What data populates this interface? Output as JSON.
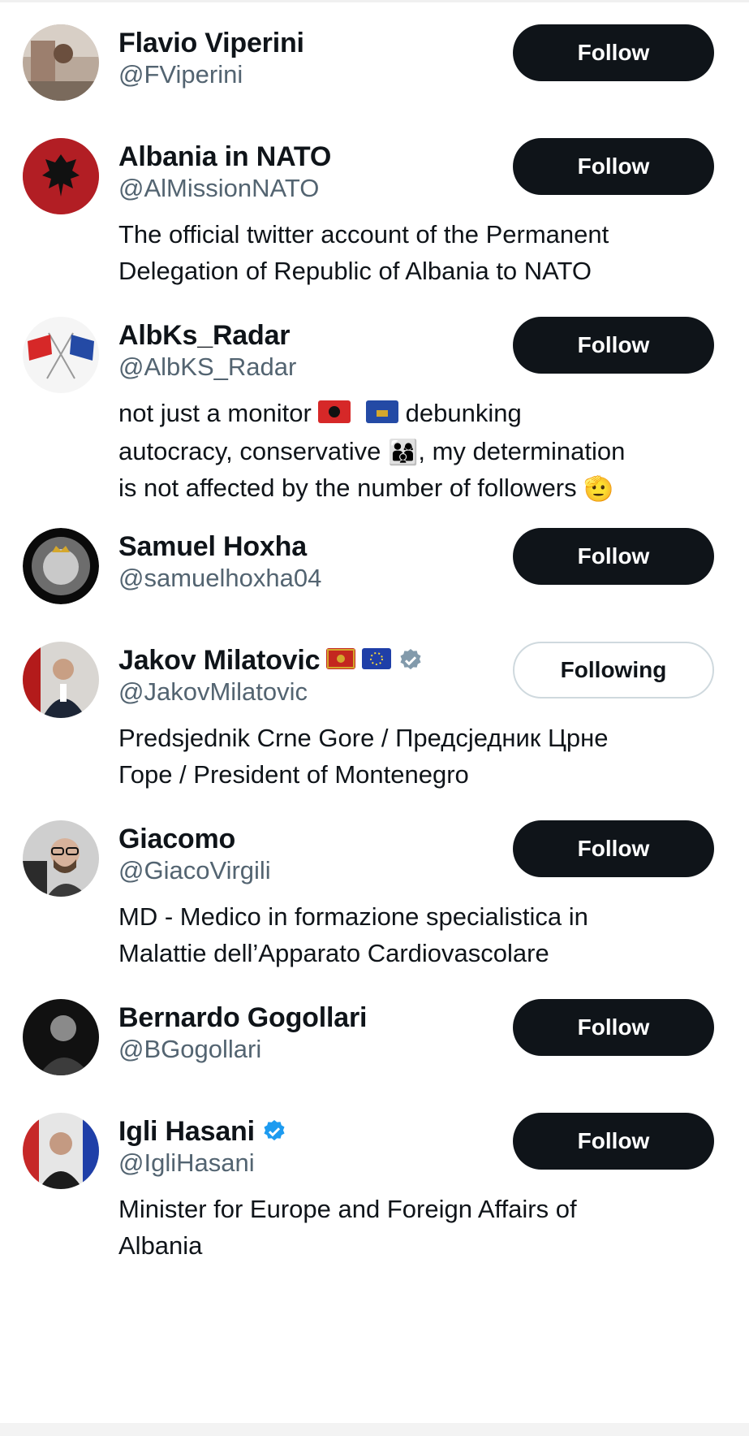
{
  "colors": {
    "text_primary": "#0f1419",
    "text_secondary": "#536471",
    "follow_button_bg": "#0f1419",
    "following_border": "#cfd9de",
    "verified_blue": "#1d9bf0",
    "verified_gray": "#829aab"
  },
  "users": [
    {
      "name": "Flavio Viperini",
      "handle": "@FViperini",
      "bio_lines": [],
      "button": "Follow"
    },
    {
      "name": "Albania in NATO",
      "handle": "@AlMissionNATO",
      "bio_lines": [
        "The official twitter account of the Permanent",
        "Delegation of Republic of Albania to NATO"
      ],
      "button": "Follow"
    },
    {
      "name": "AlbKs_Radar",
      "handle": "@AlbKS_Radar",
      "bio_lines": [
        "not just a monitor",
        "debunking",
        "autocracy, conservative",
        ", my determination",
        "is not affected by the number of followers"
      ],
      "button": "Follow"
    },
    {
      "name": "Samuel Hoxha",
      "handle": "@samuelhoxha04",
      "bio_lines": [],
      "button": "Follow"
    },
    {
      "name": "Jakov Milatovic",
      "handle": "@JakovMilatovic",
      "bio_lines": [
        "Predsjednik Crne Gore / Предсједник Црне",
        "Горе / President of Montenegro"
      ],
      "button": "Following",
      "badge": "gray-verified-icon"
    },
    {
      "name": "Giacomo",
      "handle": "@GiacoVirgili",
      "bio_lines": [
        "MD - Medico in formazione specialistica in",
        "Malattie dell’Apparato Cardiovascolare"
      ],
      "button": "Follow"
    },
    {
      "name": "Bernardo Gogollari",
      "handle": "@BGogollari",
      "bio_lines": [],
      "button": "Follow"
    },
    {
      "name": "Igli Hasani",
      "handle": "@IgliHasani",
      "bio_lines": [
        "Minister for Europe and Foreign Affairs of",
        "Albania"
      ],
      "button": "Follow",
      "badge": "blue-verified-icon"
    }
  ]
}
